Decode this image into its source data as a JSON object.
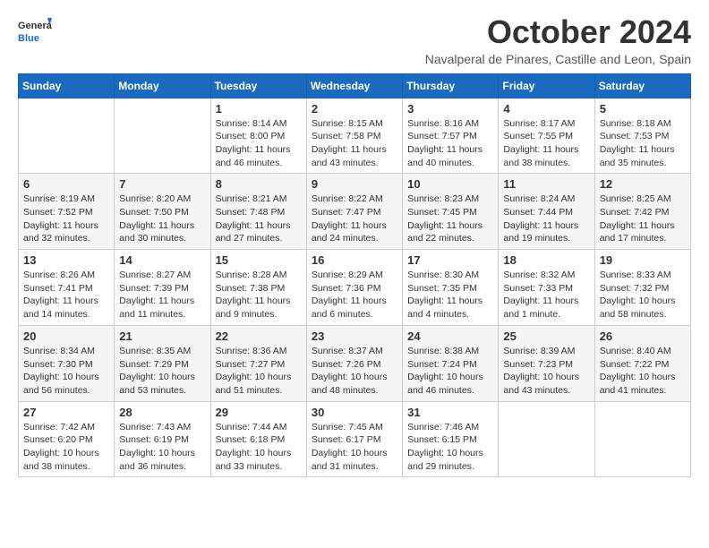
{
  "header": {
    "logo_line1": "General",
    "logo_line2": "Blue",
    "title": "October 2024",
    "subtitle": "Navalperal de Pinares, Castille and Leon, Spain"
  },
  "days_of_week": [
    "Sunday",
    "Monday",
    "Tuesday",
    "Wednesday",
    "Thursday",
    "Friday",
    "Saturday"
  ],
  "weeks": [
    [
      {
        "day": "",
        "info": ""
      },
      {
        "day": "",
        "info": ""
      },
      {
        "day": "1",
        "info": "Sunrise: 8:14 AM\nSunset: 8:00 PM\nDaylight: 11 hours and 46 minutes."
      },
      {
        "day": "2",
        "info": "Sunrise: 8:15 AM\nSunset: 7:58 PM\nDaylight: 11 hours and 43 minutes."
      },
      {
        "day": "3",
        "info": "Sunrise: 8:16 AM\nSunset: 7:57 PM\nDaylight: 11 hours and 40 minutes."
      },
      {
        "day": "4",
        "info": "Sunrise: 8:17 AM\nSunset: 7:55 PM\nDaylight: 11 hours and 38 minutes."
      },
      {
        "day": "5",
        "info": "Sunrise: 8:18 AM\nSunset: 7:53 PM\nDaylight: 11 hours and 35 minutes."
      }
    ],
    [
      {
        "day": "6",
        "info": "Sunrise: 8:19 AM\nSunset: 7:52 PM\nDaylight: 11 hours and 32 minutes."
      },
      {
        "day": "7",
        "info": "Sunrise: 8:20 AM\nSunset: 7:50 PM\nDaylight: 11 hours and 30 minutes."
      },
      {
        "day": "8",
        "info": "Sunrise: 8:21 AM\nSunset: 7:48 PM\nDaylight: 11 hours and 27 minutes."
      },
      {
        "day": "9",
        "info": "Sunrise: 8:22 AM\nSunset: 7:47 PM\nDaylight: 11 hours and 24 minutes."
      },
      {
        "day": "10",
        "info": "Sunrise: 8:23 AM\nSunset: 7:45 PM\nDaylight: 11 hours and 22 minutes."
      },
      {
        "day": "11",
        "info": "Sunrise: 8:24 AM\nSunset: 7:44 PM\nDaylight: 11 hours and 19 minutes."
      },
      {
        "day": "12",
        "info": "Sunrise: 8:25 AM\nSunset: 7:42 PM\nDaylight: 11 hours and 17 minutes."
      }
    ],
    [
      {
        "day": "13",
        "info": "Sunrise: 8:26 AM\nSunset: 7:41 PM\nDaylight: 11 hours and 14 minutes."
      },
      {
        "day": "14",
        "info": "Sunrise: 8:27 AM\nSunset: 7:39 PM\nDaylight: 11 hours and 11 minutes."
      },
      {
        "day": "15",
        "info": "Sunrise: 8:28 AM\nSunset: 7:38 PM\nDaylight: 11 hours and 9 minutes."
      },
      {
        "day": "16",
        "info": "Sunrise: 8:29 AM\nSunset: 7:36 PM\nDaylight: 11 hours and 6 minutes."
      },
      {
        "day": "17",
        "info": "Sunrise: 8:30 AM\nSunset: 7:35 PM\nDaylight: 11 hours and 4 minutes."
      },
      {
        "day": "18",
        "info": "Sunrise: 8:32 AM\nSunset: 7:33 PM\nDaylight: 11 hours and 1 minute."
      },
      {
        "day": "19",
        "info": "Sunrise: 8:33 AM\nSunset: 7:32 PM\nDaylight: 10 hours and 58 minutes."
      }
    ],
    [
      {
        "day": "20",
        "info": "Sunrise: 8:34 AM\nSunset: 7:30 PM\nDaylight: 10 hours and 56 minutes."
      },
      {
        "day": "21",
        "info": "Sunrise: 8:35 AM\nSunset: 7:29 PM\nDaylight: 10 hours and 53 minutes."
      },
      {
        "day": "22",
        "info": "Sunrise: 8:36 AM\nSunset: 7:27 PM\nDaylight: 10 hours and 51 minutes."
      },
      {
        "day": "23",
        "info": "Sunrise: 8:37 AM\nSunset: 7:26 PM\nDaylight: 10 hours and 48 minutes."
      },
      {
        "day": "24",
        "info": "Sunrise: 8:38 AM\nSunset: 7:24 PM\nDaylight: 10 hours and 46 minutes."
      },
      {
        "day": "25",
        "info": "Sunrise: 8:39 AM\nSunset: 7:23 PM\nDaylight: 10 hours and 43 minutes."
      },
      {
        "day": "26",
        "info": "Sunrise: 8:40 AM\nSunset: 7:22 PM\nDaylight: 10 hours and 41 minutes."
      }
    ],
    [
      {
        "day": "27",
        "info": "Sunrise: 7:42 AM\nSunset: 6:20 PM\nDaylight: 10 hours and 38 minutes."
      },
      {
        "day": "28",
        "info": "Sunrise: 7:43 AM\nSunset: 6:19 PM\nDaylight: 10 hours and 36 minutes."
      },
      {
        "day": "29",
        "info": "Sunrise: 7:44 AM\nSunset: 6:18 PM\nDaylight: 10 hours and 33 minutes."
      },
      {
        "day": "30",
        "info": "Sunrise: 7:45 AM\nSunset: 6:17 PM\nDaylight: 10 hours and 31 minutes."
      },
      {
        "day": "31",
        "info": "Sunrise: 7:46 AM\nSunset: 6:15 PM\nDaylight: 10 hours and 29 minutes."
      },
      {
        "day": "",
        "info": ""
      },
      {
        "day": "",
        "info": ""
      }
    ]
  ]
}
